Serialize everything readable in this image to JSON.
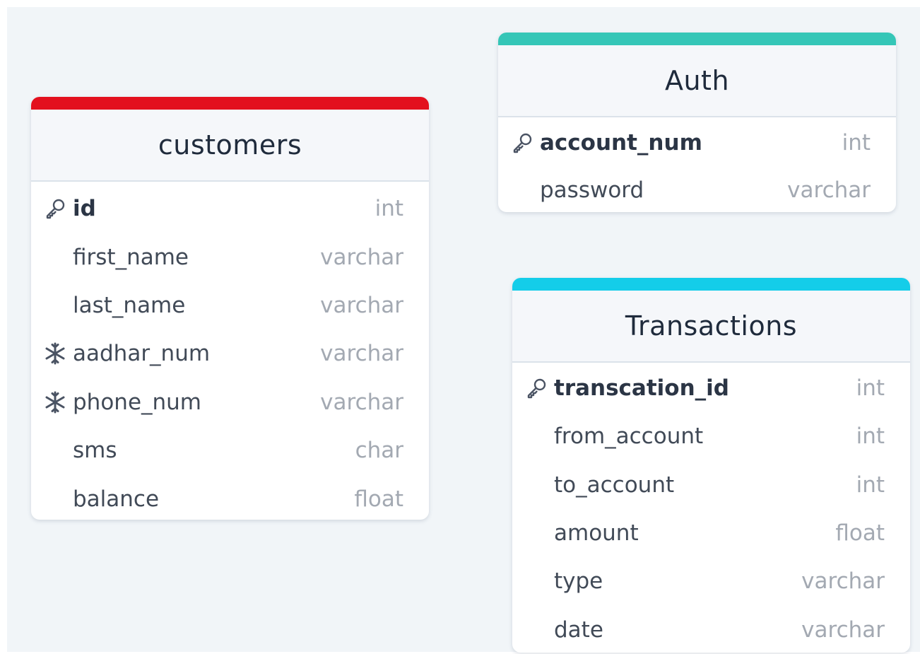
{
  "colors": {
    "background": "#f1f5f8",
    "customers_accent": "#e3101e",
    "auth_accent": "#35c6b7",
    "transactions_accent": "#14cde9"
  },
  "tables": {
    "customers": {
      "title": "customers",
      "columns": [
        {
          "name": "id",
          "type": "int",
          "icon": "key-icon"
        },
        {
          "name": "first_name",
          "type": "varchar",
          "icon": ""
        },
        {
          "name": "last_name",
          "type": "varchar",
          "icon": ""
        },
        {
          "name": "aadhar_num",
          "type": "varchar",
          "icon": "snowflake-icon"
        },
        {
          "name": "phone_num",
          "type": "varchar",
          "icon": "snowflake-icon"
        },
        {
          "name": "sms",
          "type": "char",
          "icon": ""
        },
        {
          "name": "balance",
          "type": "float",
          "icon": ""
        }
      ]
    },
    "auth": {
      "title": "Auth",
      "columns": [
        {
          "name": "account_num",
          "type": "int",
          "icon": "key-icon"
        },
        {
          "name": "password",
          "type": "varchar",
          "icon": ""
        }
      ]
    },
    "transactions": {
      "title": "Transactions",
      "columns": [
        {
          "name": "transcation_id",
          "type": "int",
          "icon": "key-icon"
        },
        {
          "name": "from_account",
          "type": "int",
          "icon": ""
        },
        {
          "name": "to_account",
          "type": "int",
          "icon": ""
        },
        {
          "name": "amount",
          "type": "float",
          "icon": ""
        },
        {
          "name": "type",
          "type": "varchar",
          "icon": ""
        },
        {
          "name": "date",
          "type": "varchar",
          "icon": ""
        }
      ]
    }
  }
}
